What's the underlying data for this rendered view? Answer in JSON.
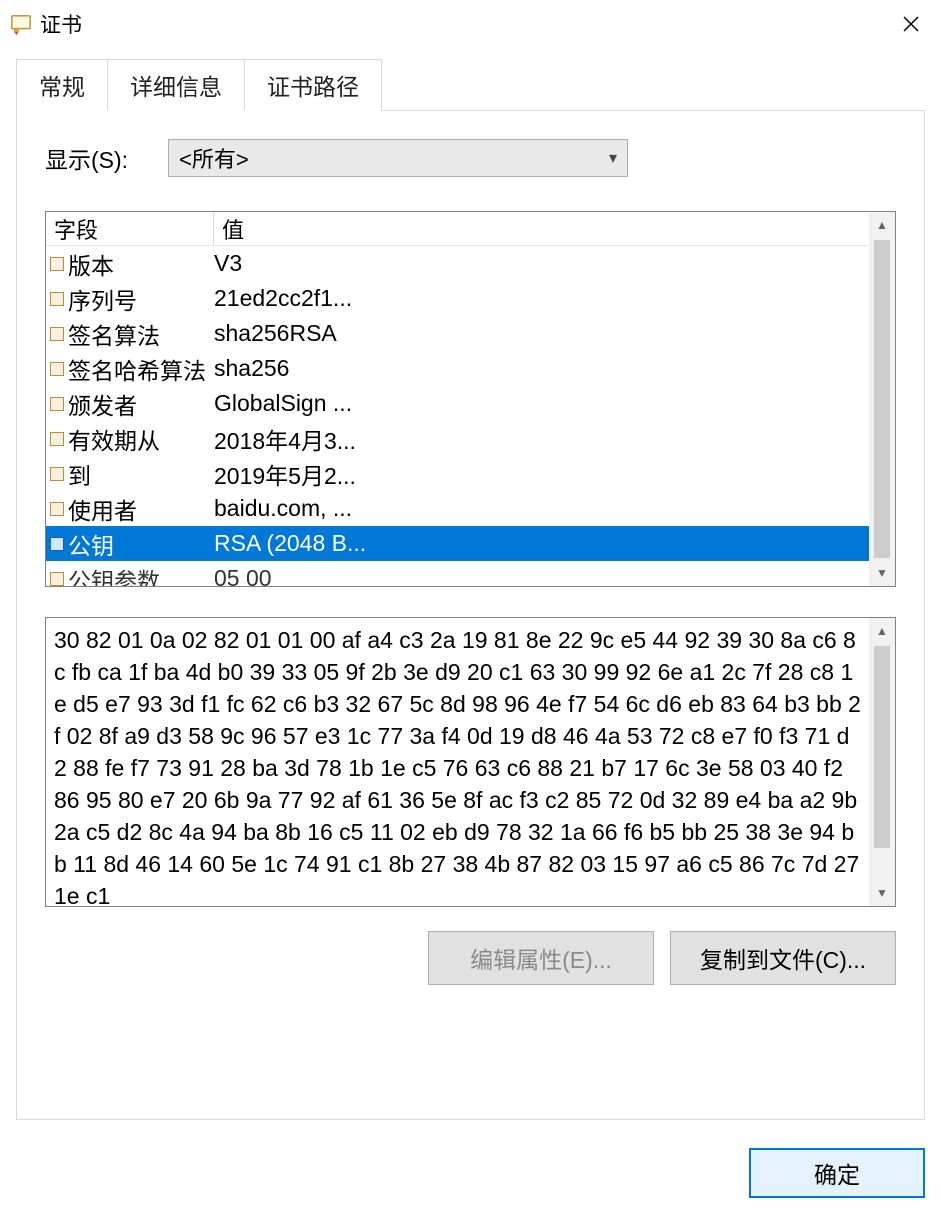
{
  "window": {
    "title": "证书"
  },
  "tabs": {
    "general": "常规",
    "details": "详细信息",
    "path": "证书路径"
  },
  "show": {
    "label": "显示(S):",
    "value": "<所有>"
  },
  "columns": {
    "field": "字段",
    "value": "值"
  },
  "rows": [
    {
      "field": "版本",
      "value": "V3"
    },
    {
      "field": "序列号",
      "value": "21ed2cc2f1..."
    },
    {
      "field": "签名算法",
      "value": "sha256RSA"
    },
    {
      "field": "签名哈希算法",
      "value": "sha256"
    },
    {
      "field": "颁发者",
      "value": "GlobalSign ..."
    },
    {
      "field": "有效期从",
      "value": "2018年4月3..."
    },
    {
      "field": "到",
      "value": "2019年5月2..."
    },
    {
      "field": "使用者",
      "value": "baidu.com, ..."
    },
    {
      "field": "公钥",
      "value": "RSA (2048 B..."
    },
    {
      "field": "公钥参数",
      "value": "05 00"
    }
  ],
  "selected_index": 8,
  "detail_text": "30 82 01 0a 02 82 01 01 00 af a4 c3 2a 19 81 8e 22 9c e5 44 92 39 30 8a c6 8c fb ca 1f ba 4d b0 39 33 05 9f 2b 3e d9 20 c1 63 30 99 92 6e a1 2c 7f 28 c8 1e d5 e7 93 3d f1 fc 62 c6 b3 32 67 5c 8d 98 96 4e f7 54 6c d6 eb 83 64 b3 bb 2f 02 8f a9 d3 58 9c 96 57 e3 1c 77 3a f4 0d 19 d8 46 4a 53 72 c8 e7 f0 f3 71 d2 88 fe f7 73 91 28 ba 3d 78 1b 1e c5 76 63 c6 88 21 b7 17 6c 3e 58 03 40 f2 86 95 80 e7 20 6b 9a 77 92 af 61 36 5e 8f ac f3 c2 85 72 0d 32 89 e4 ba a2 9b 2a c5 d2 8c 4a 94 ba 8b 16 c5 11 02 eb d9 78 32 1a 66 f6 b5 bb 25 38 3e 94 bb 11 8d 46 14 60 5e 1c 74 91 c1 8b 27 38 4b 87 82 03 15 97 a6 c5 86 7c 7d 27 1e c1",
  "buttons": {
    "edit_props": "编辑属性(E)...",
    "copy_to_file": "复制到文件(C)...",
    "ok": "确定"
  }
}
